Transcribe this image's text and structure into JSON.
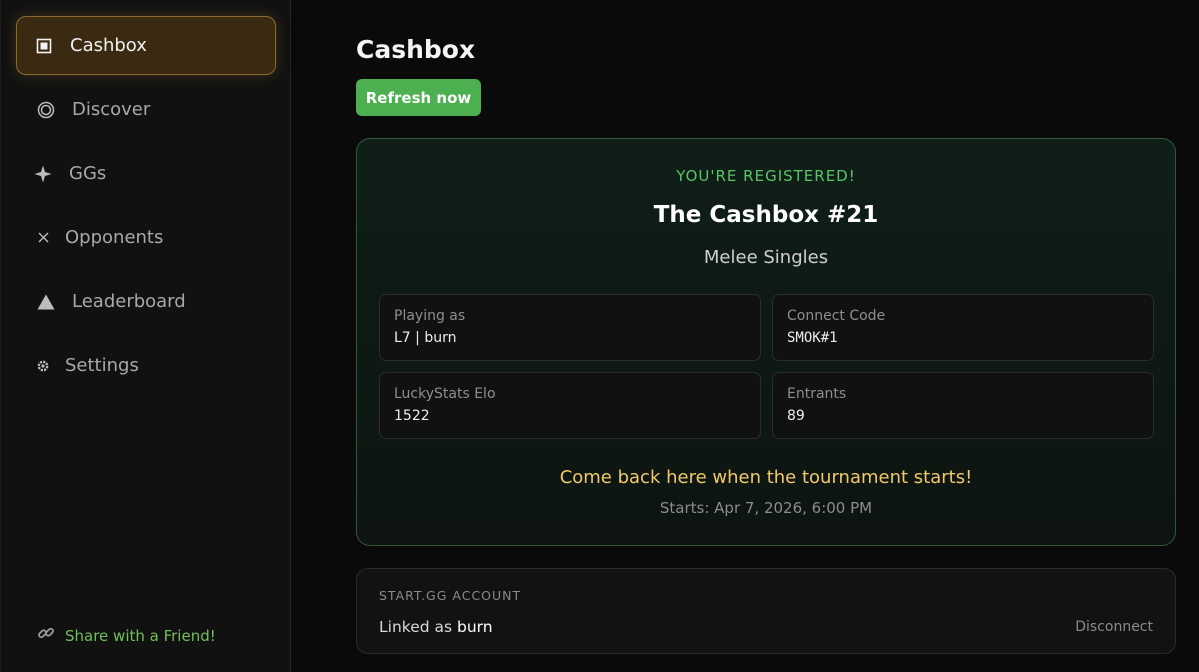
{
  "sidebar": {
    "items": [
      {
        "label": "Cashbox",
        "icon": "square-icon",
        "active": true
      },
      {
        "label": "Discover",
        "icon": "target-icon",
        "active": false
      },
      {
        "label": "GGs",
        "icon": "sparkle-icon",
        "active": false
      },
      {
        "label": "Opponents",
        "icon": "crossed-swords-icon",
        "active": false
      },
      {
        "label": "Leaderboard",
        "icon": "triangle-icon",
        "active": false
      },
      {
        "label": "Settings",
        "icon": "gear-icon",
        "active": false
      }
    ],
    "share_label": "Share with a Friend!"
  },
  "main": {
    "title": "Cashbox",
    "refresh_label": "Refresh now",
    "registration": {
      "status_label": "YOU'RE REGISTERED!",
      "tournament_name": "The Cashbox #21",
      "event_name": "Melee Singles",
      "fields": [
        {
          "label": "Playing as",
          "value": "L7 | burn"
        },
        {
          "label": "Connect Code",
          "value": "SMOK#1"
        },
        {
          "label": "LuckyStats Elo",
          "value": "1522"
        },
        {
          "label": "Entrants",
          "value": "89"
        }
      ],
      "message": "Come back here when the tournament starts!",
      "starts": "Starts: Apr 7, 2026, 6:00 PM"
    },
    "account": {
      "heading": "START.GG ACCOUNT",
      "linked_prefix": "Linked as",
      "linked_user": "burn",
      "disconnect_label": "Disconnect"
    }
  },
  "colors": {
    "accent_green": "#4caf50",
    "active_nav_bg": "#3a2a12",
    "active_nav_border": "#8a6a2e",
    "highlight_yellow": "#f1c96a"
  }
}
